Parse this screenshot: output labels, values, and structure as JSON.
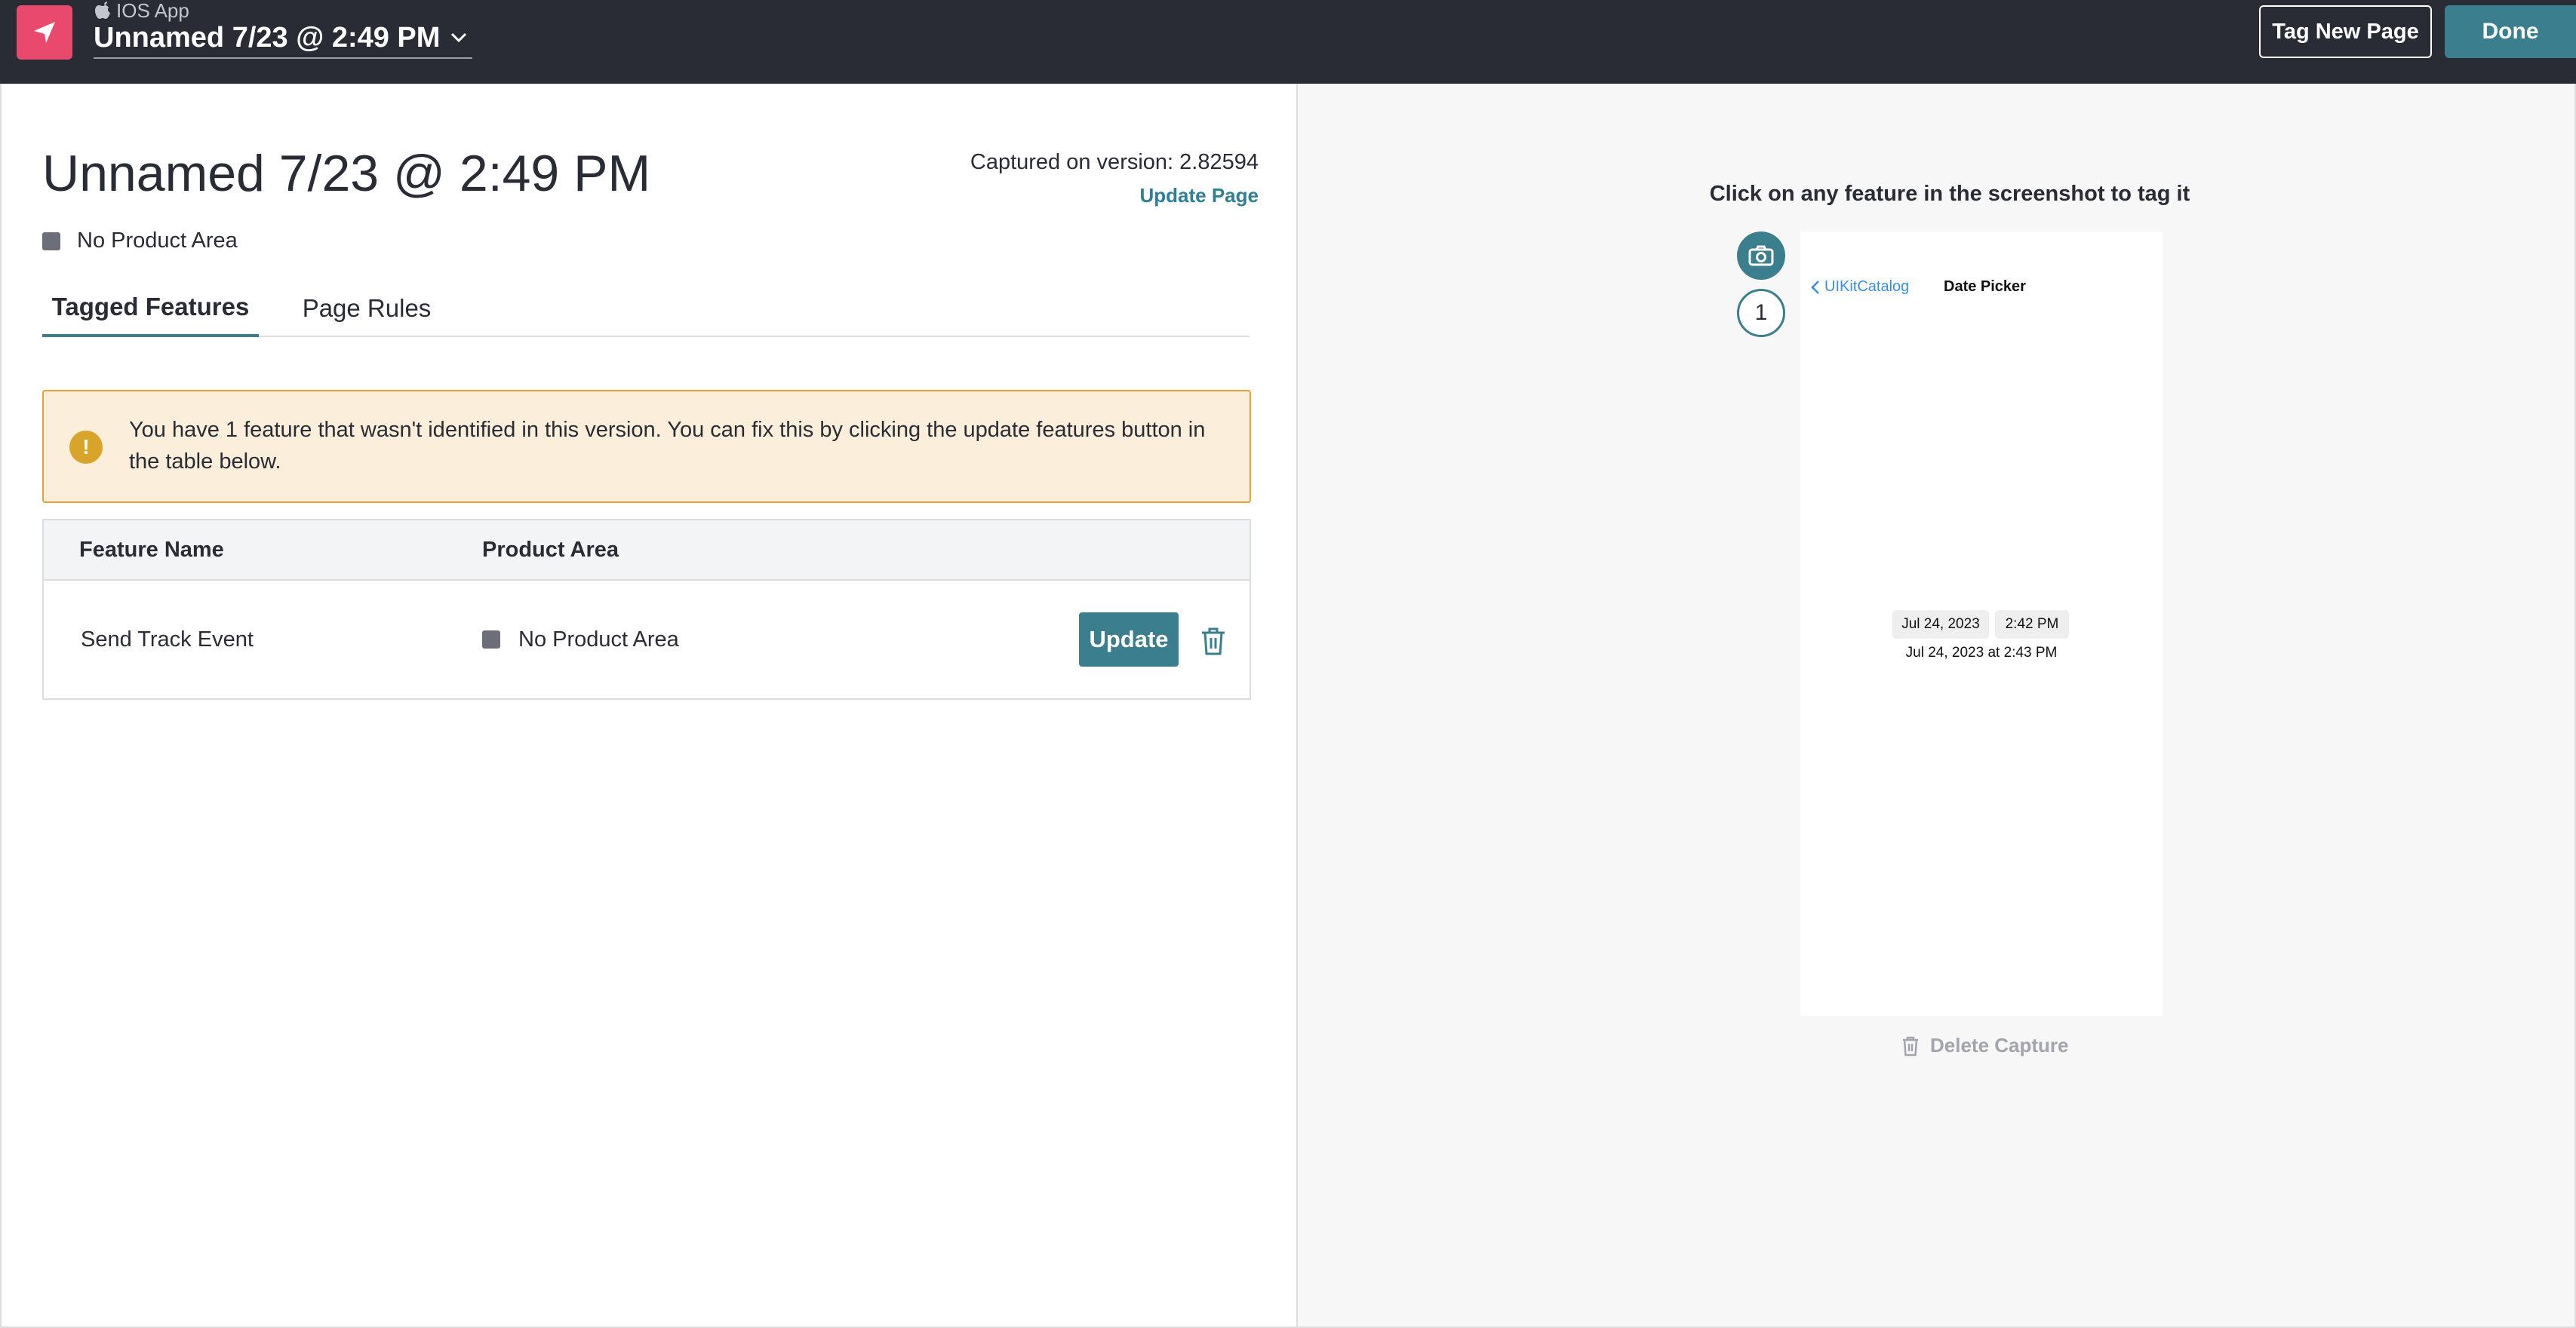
{
  "header": {
    "app_label": "IOS App",
    "page_name": "Unnamed 7/23 @ 2:49 PM",
    "tag_new_page_label": "Tag New Page",
    "done_label": "Done"
  },
  "page": {
    "title": "Unnamed 7/23 @ 2:49 PM",
    "product_area": "No Product Area",
    "captured_version": "Captured on version: 2.82594",
    "update_page_label": "Update Page"
  },
  "tabs": [
    {
      "label": "Tagged Features",
      "active": true
    },
    {
      "label": "Page Rules",
      "active": false
    }
  ],
  "alert": {
    "icon": "!",
    "message": "You have 1 feature that wasn't identified in this version. You can fix this by clicking the update features button in the table below."
  },
  "table": {
    "headers": [
      "Feature Name",
      "Product Area"
    ],
    "rows": [
      {
        "feature_name": "Send Track Event",
        "product_area": "No Product Area",
        "update_label": "Update"
      }
    ]
  },
  "capture": {
    "hint": "Click on any feature in the screenshot to tag it",
    "capture_number": "1",
    "delete_label": "Delete Capture",
    "phone": {
      "back_label": "UIKitCatalog",
      "title": "Date Picker",
      "date_chip": "Jul 24, 2023",
      "time_chip": "2:42 PM",
      "summary": "Jul 24, 2023 at 2:43 PM"
    }
  },
  "colors": {
    "topbar": "#2a2c35",
    "brand": "#e8496c",
    "accent": "#3b7f8e",
    "alert_bg": "#fbeedb",
    "alert_border": "#e5a23a",
    "link": "#2f7f96"
  }
}
